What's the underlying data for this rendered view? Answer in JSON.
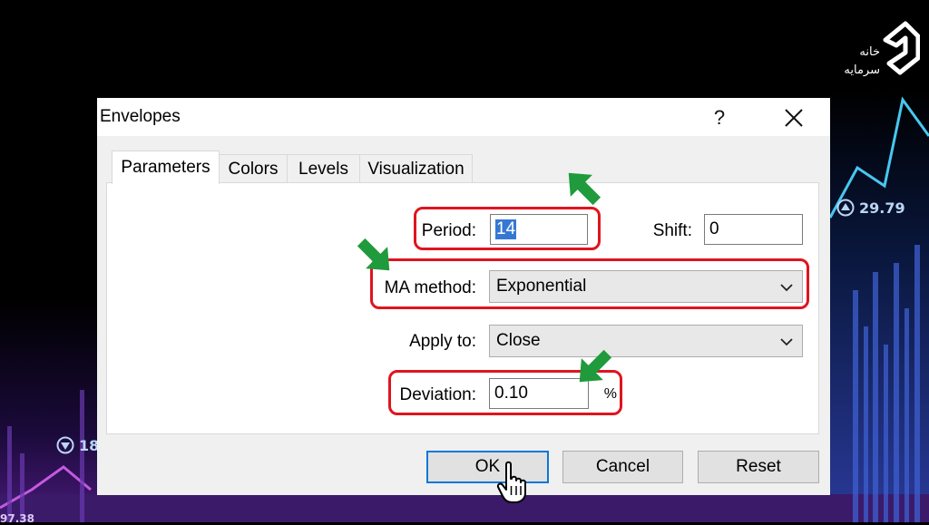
{
  "brand": {
    "line1": "خانه",
    "line2": "سرمایه"
  },
  "background": {
    "price_up": "29.79",
    "price_down": "18",
    "price_bottom": "97.38"
  },
  "dialog": {
    "title": "Envelopes",
    "help_label": "?",
    "tabs": [
      {
        "label": "Parameters",
        "active": true
      },
      {
        "label": "Colors",
        "active": false
      },
      {
        "label": "Levels",
        "active": false
      },
      {
        "label": "Visualization",
        "active": false
      }
    ],
    "fields": {
      "period_label": "Period:",
      "period_value": "14",
      "shift_label": "Shift:",
      "shift_value": "0",
      "ma_method_label": "MA method:",
      "ma_method_value": "Exponential",
      "apply_to_label": "Apply to:",
      "apply_to_value": "Close",
      "deviation_label": "Deviation:",
      "deviation_value": "0.10",
      "deviation_unit": "%"
    },
    "buttons": {
      "ok": "OK",
      "cancel": "Cancel",
      "reset": "Reset"
    }
  },
  "colors": {
    "highlight": "#e0141e",
    "arrow": "#1f9a3c",
    "selection": "#3578d4",
    "default_button_border": "#0a78d7"
  },
  "icons": [
    "close-icon",
    "chevron-down-icon",
    "arrow-pointer-icon",
    "hand-cursor-icon",
    "triangle-up-icon",
    "triangle-down-icon"
  ]
}
